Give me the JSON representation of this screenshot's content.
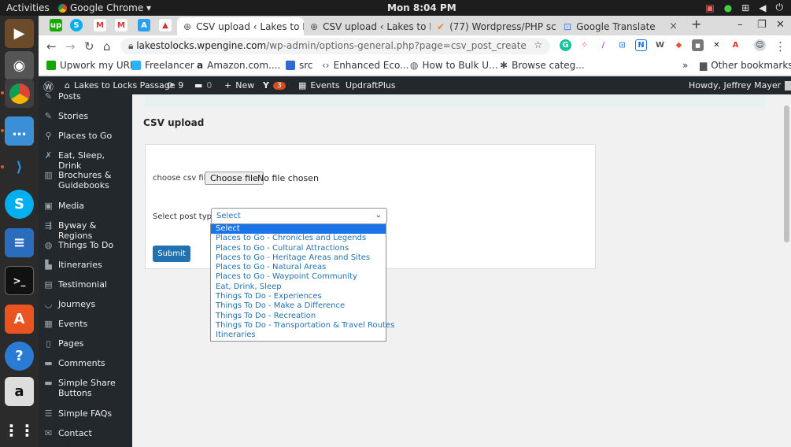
{
  "topbar": {
    "activities": "Activities",
    "app": "Google Chrome ▾",
    "clock": "Mon  8:04 PM"
  },
  "tabs": [
    {
      "label": "CSV upload ‹ Lakes to L",
      "close": "×"
    },
    {
      "label": "CSV upload ‹ Lakes to L",
      "close": "×"
    },
    {
      "label": "(77) Wordpress/PHP sc",
      "close": "×"
    },
    {
      "label": "Google Translate",
      "close": "×"
    }
  ],
  "new_tab": "+",
  "omnibox": {
    "host": "lakestolocks.wpengine.com",
    "path": "/wp-admin/options-general.php?page=csv_post_create"
  },
  "bookmarks": [
    "Upwork my URL",
    "Freelancer",
    "Amazon.com....",
    "src",
    "Enhanced Eco...",
    "How to Bulk U...",
    "Browse categ..."
  ],
  "bookmarks_more": "»",
  "other_bookmarks": "Other bookmarks",
  "adminbar": {
    "site": "Lakes to Locks Passage",
    "updates": "9",
    "comments": "0",
    "new": "New",
    "yoast_badge": "3",
    "events": "Events",
    "updraft": "UpdraftPlus",
    "howdy": "Howdy, Jeffrey Mayer"
  },
  "menu": [
    "Posts",
    "Stories",
    "Places to Go",
    "Eat, Sleep, Drink",
    "Brochures & Guidebooks",
    "Media",
    "Byway & Regions",
    "Things To Do",
    "Itineraries",
    "Testimonial",
    "Journeys",
    "Events",
    "Pages",
    "Comments",
    "Simple Share Buttons",
    "Simple FAQs",
    "Contact"
  ],
  "page": {
    "title": "CSV upload",
    "file_label": "choose csv file",
    "file_button": "Choose file",
    "file_status": "No file chosen",
    "post_type_label": "Select post type",
    "select_value": "Select",
    "submit": "Submit"
  },
  "options": [
    "Select",
    "Places to Go - Chronicles and Legends",
    "Places to Go - Cultural Attractions",
    "Places to Go - Heritage Areas and Sites",
    "Places to Go - Natural Areas",
    "Places to Go - Waypoint Community",
    "Eat, Drink, Sleep",
    "Things To Do - Experiences",
    "Things To Do - Make a Difference",
    "Things To Do - Recreation",
    "Things To Do - Transportation & Travel Routes",
    "Itineraries"
  ],
  "colors": {
    "wp_dark": "#23282d",
    "wp_blue": "#2271b1",
    "ubuntu_orange": "#e95420",
    "highlight": "#1a73e8"
  }
}
